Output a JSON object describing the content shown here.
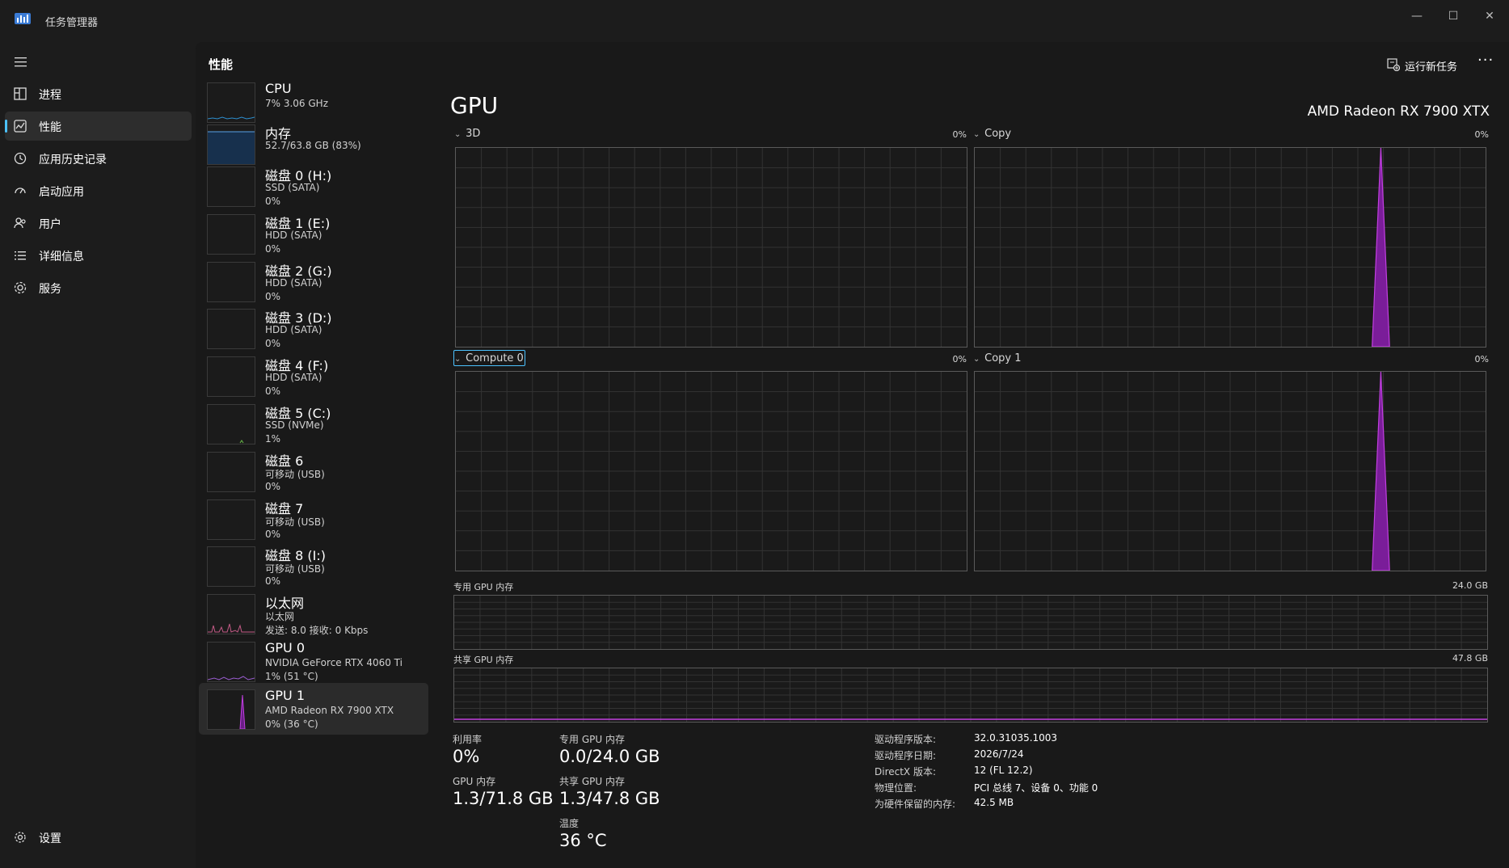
{
  "window": {
    "title": "任务管理器",
    "minimize": "—",
    "maximize": "☐",
    "close": "✕"
  },
  "nav": {
    "items": [
      {
        "label": "进程",
        "icon": "processes-icon"
      },
      {
        "label": "性能",
        "icon": "performance-icon",
        "active": true
      },
      {
        "label": "应用历史记录",
        "icon": "history-icon"
      },
      {
        "label": "启动应用",
        "icon": "startup-icon"
      },
      {
        "label": "用户",
        "icon": "users-icon"
      },
      {
        "label": "详细信息",
        "icon": "details-icon"
      },
      {
        "label": "服务",
        "icon": "services-icon"
      }
    ],
    "settings": {
      "label": "设置",
      "icon": "gear-icon"
    }
  },
  "header": {
    "title": "性能",
    "run_task": "运行新任务",
    "more": "···"
  },
  "devices": [
    {
      "name": "CPU",
      "sub": "7% 3.06 GHz",
      "value": ""
    },
    {
      "name": "内存",
      "sub": "52.7/63.8 GB (83%)",
      "value": ""
    },
    {
      "name": "磁盘 0 (H:)",
      "sub": "SSD (SATA)",
      "value": "0%"
    },
    {
      "name": "磁盘 1 (E:)",
      "sub": "HDD (SATA)",
      "value": "0%"
    },
    {
      "name": "磁盘 2 (G:)",
      "sub": "HDD (SATA)",
      "value": "0%"
    },
    {
      "name": "磁盘 3 (D:)",
      "sub": "HDD (SATA)",
      "value": "0%"
    },
    {
      "name": "磁盘 4 (F:)",
      "sub": "HDD (SATA)",
      "value": "0%"
    },
    {
      "name": "磁盘 5 (C:)",
      "sub": "SSD (NVMe)",
      "value": "1%"
    },
    {
      "name": "磁盘 6",
      "sub": "可移动 (USB)",
      "value": "0%"
    },
    {
      "name": "磁盘 7",
      "sub": "可移动 (USB)",
      "value": "0%"
    },
    {
      "name": "磁盘 8 (I:)",
      "sub": "可移动 (USB)",
      "value": "0%"
    },
    {
      "name": "以太网",
      "sub": "以太网",
      "value": "发送: 8.0 接收: 0 Kbps"
    },
    {
      "name": "GPU 0",
      "sub": "NVIDIA GeForce RTX 4060 Ti",
      "value": "1% (51 °C)"
    },
    {
      "name": "GPU 1",
      "sub": "AMD Radeon RX 7900 XTX",
      "value": "0% (36 °C)",
      "selected": true
    }
  ],
  "gpu": {
    "title": "GPU",
    "model": "AMD Radeon RX 7900 XTX",
    "engines": [
      {
        "label": "3D",
        "percent": "0%"
      },
      {
        "label": "Copy",
        "percent": "0%"
      },
      {
        "label": "Compute 0",
        "percent": "0%"
      },
      {
        "label": "Copy 1",
        "percent": "0%"
      }
    ],
    "dedicated_memory": {
      "label": "专用 GPU 内存",
      "max": "24.0 GB"
    },
    "shared_memory": {
      "label": "共享 GPU 内存",
      "max": "47.8 GB"
    },
    "stats": {
      "utilization": {
        "label": "利用率",
        "value": "0%"
      },
      "dedicated": {
        "label": "专用 GPU 内存",
        "value": "0.0/24.0 GB"
      },
      "gpu_memory": {
        "label": "GPU 内存",
        "value": "1.3/71.8 GB"
      },
      "shared": {
        "label": "共享 GPU 内存",
        "value": "1.3/47.8 GB"
      },
      "temperature": {
        "label": "温度",
        "value": "36 °C"
      }
    },
    "info": [
      {
        "key": "驱动程序版本:",
        "value": "32.0.31035.1003"
      },
      {
        "key": "驱动程序日期:",
        "value": "2026/7/24"
      },
      {
        "key": "DirectX 版本:",
        "value": "12 (FL 12.2)"
      },
      {
        "key": "物理位置:",
        "value": "PCI 总线 7、设备 0、功能 0"
      },
      {
        "key": "为硬件保留的内存:",
        "value": "42.5 MB"
      }
    ]
  },
  "colors": {
    "accent": "#4cc2ff",
    "gpu_line": "#c13fe0",
    "grid": "#333333"
  }
}
